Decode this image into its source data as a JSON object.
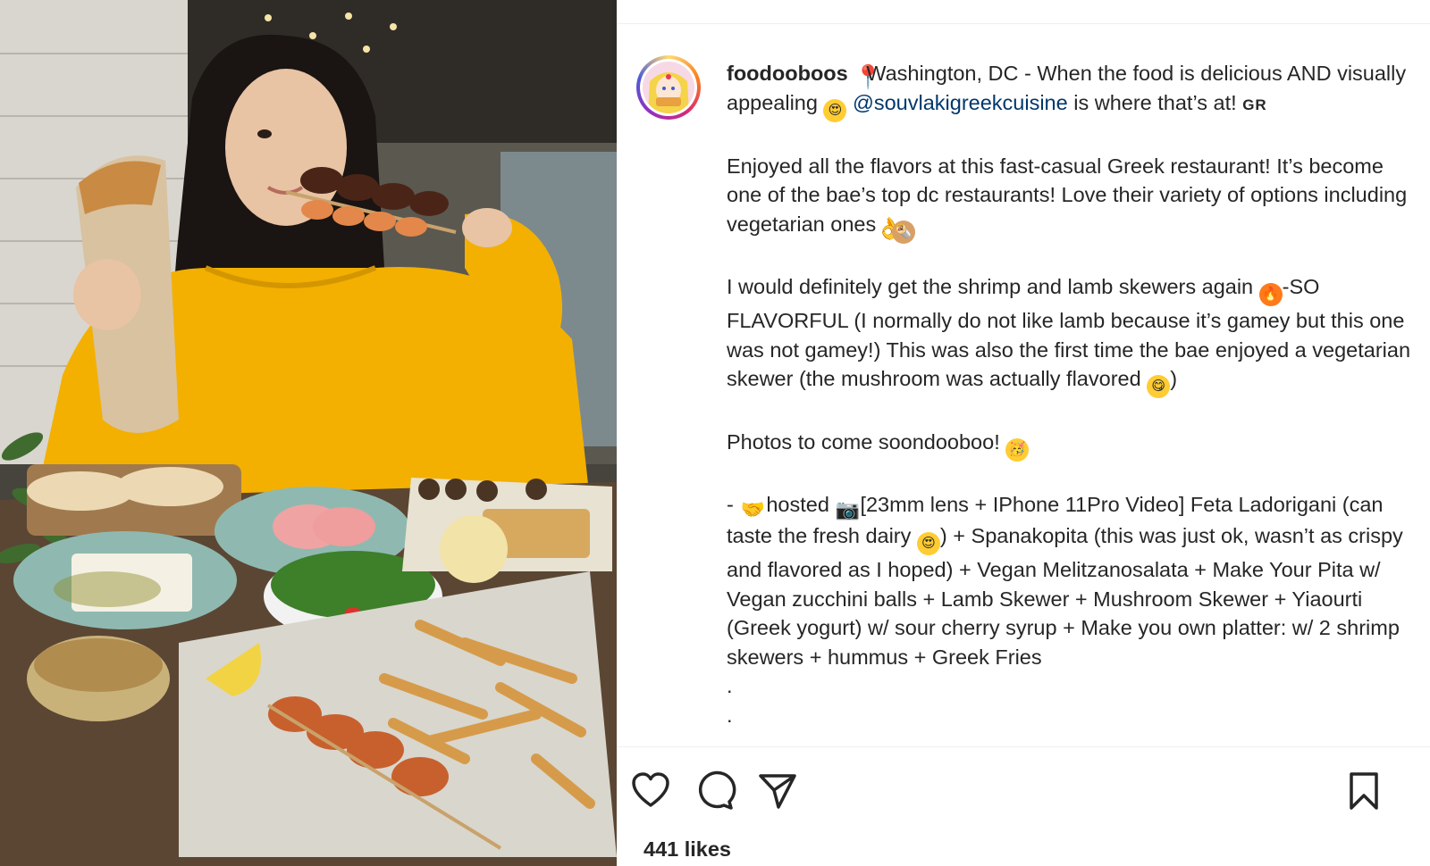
{
  "post": {
    "username": "foodooboos",
    "caption_line1_text": "Washington, DC - When the food is delicious AND visually appealing",
    "mention": "@souvlakigreekcuisine",
    "caption_line1_tail": "is where that’s at!",
    "caption_line1_suffix": "GR",
    "para2": "Enjoyed all the flavors at this fast-casual Greek restaurant! It’s become one of the bae’s top dc restaurants! Love their variety of options including vegetarian ones",
    "para3_a": "I would definitely get the shrimp and lamb skewers again",
    "para3_b": "-SO FLAVORFUL (I normally do not like lamb because it’s gamey but this one was not gamey!) This was also the first time the bae enjoyed a vegetarian skewer (the mushroom was actually flavored",
    "para3_c": ")",
    "para4": "Photos to come soondooboo!",
    "para5_a": "- ",
    "para5_b": "hosted ",
    "para5_c": "[23mm lens + IPhone 11Pro Video] Feta Ladorigani (can taste the fresh dairy",
    "para5_d": ") + Spanakopita (this was just ok, wasn’t as crispy and flavored as I hoped) + Vegan Melitzanosalata + Make Your Pita w/ Vegan zucchini balls + Lamb Skewer + Mushroom Skewer + Yiaourti (Greek yogurt) w/ sour cherry syrup + Make you own platter: w/ 2 shrimp skewers + hummus + Greek Fries",
    "dot1": ".",
    "dot2": ".",
    "likes": "441 likes"
  },
  "icons": {
    "like": "heart-icon",
    "comment": "comment-icon",
    "share": "share-icon",
    "save": "bookmark-icon",
    "location_pin": "round-pushpin-emoji",
    "heart_eyes": "heart-eyes-emoji",
    "ok_hand": "ok-hand-emoji",
    "burrito": "burrito-emoji",
    "fire": "fire-emoji",
    "yum": "yum-emoji",
    "party": "partying-face-emoji",
    "hands": "handshake-emoji",
    "camera": "camera-emoji"
  },
  "colors": {
    "mention": "#00376b",
    "text": "#262626",
    "divider": "#efefef"
  }
}
